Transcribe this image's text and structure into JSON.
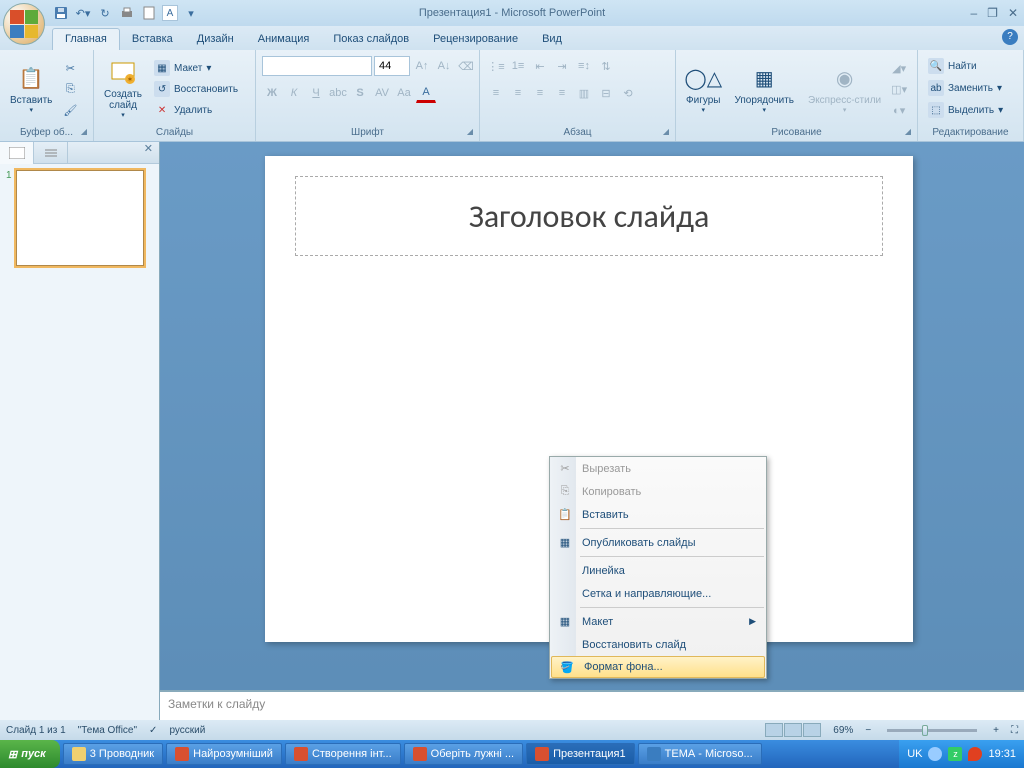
{
  "title": "Презентация1 - Microsoft PowerPoint",
  "qat_letter": "A",
  "tabs": [
    "Главная",
    "Вставка",
    "Дизайн",
    "Анимация",
    "Показ слайдов",
    "Рецензирование",
    "Вид"
  ],
  "ribbon": {
    "clipboard": {
      "paste": "Вставить",
      "title": "Буфер об..."
    },
    "slides": {
      "new": "Создать\nслайд",
      "layout": "Макет",
      "reset": "Восстановить",
      "delete": "Удалить",
      "title": "Слайды"
    },
    "font": {
      "size": "44",
      "title": "Шрифт"
    },
    "para": {
      "title": "Абзац"
    },
    "drawing": {
      "shapes": "Фигуры",
      "arrange": "Упорядочить",
      "styles": "Экспресс-стили",
      "title": "Рисование"
    },
    "editing": {
      "find": "Найти",
      "replace": "Заменить",
      "select": "Выделить",
      "title": "Редактирование"
    }
  },
  "thumb_num": "1",
  "slide_title": "Заголовок слайда",
  "notes": "Заметки к слайду",
  "ctx": {
    "cut": "Вырезать",
    "copy": "Копировать",
    "paste": "Вставить",
    "publish": "Опубликовать слайды",
    "ruler": "Линейка",
    "grid": "Сетка и направляющие...",
    "layout": "Макет",
    "reset": "Восстановить слайд",
    "format": "Формат фона..."
  },
  "status": {
    "slide": "Слайд 1 из 1",
    "theme": "\"Тема Office\"",
    "lang": "русский",
    "zoom": "69%"
  },
  "taskbar": {
    "start": "пуск",
    "tasks": [
      "3 Проводник",
      "Найрозумніший",
      "Створення інт...",
      "Оберіть лужні ...",
      "Презентация1",
      "ТЕМА - Microso..."
    ],
    "lang": "UK",
    "time": "19:31"
  }
}
